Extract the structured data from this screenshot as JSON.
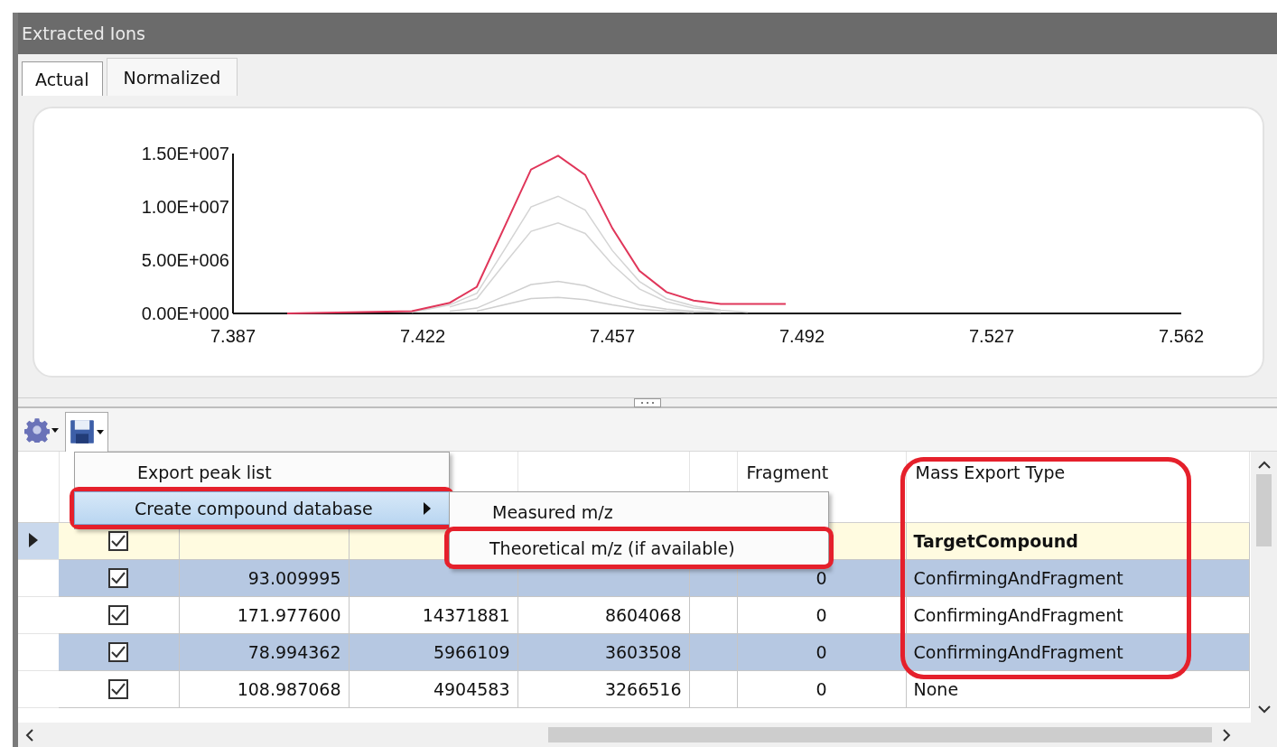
{
  "panel": {
    "title": "Extracted Ions"
  },
  "tabs": [
    {
      "label": "Actual",
      "selected": true
    },
    {
      "label": "Normalized",
      "selected": false
    }
  ],
  "chart": {
    "chart_data": {
      "type": "line",
      "x": [
        7.397,
        7.42,
        7.427,
        7.432,
        7.437,
        7.442,
        7.447,
        7.452,
        7.457,
        7.462,
        7.467,
        7.472,
        7.477,
        7.482,
        7.489
      ],
      "xlim": [
        7.387,
        7.562
      ],
      "ylim": [
        0,
        15000000
      ],
      "xticks": [
        {
          "value": 7.387,
          "label": "7.387"
        },
        {
          "value": 7.422,
          "label": "7.422"
        },
        {
          "value": 7.457,
          "label": "7.457"
        },
        {
          "value": 7.492,
          "label": "7.492"
        },
        {
          "value": 7.527,
          "label": "7.527"
        },
        {
          "value": 7.562,
          "label": "7.562"
        }
      ],
      "yticks": [
        {
          "value": 0,
          "label": "0.00E+000"
        },
        {
          "value": 5000000,
          "label": "5.00E+006"
        },
        {
          "value": 10000000,
          "label": "1.00E+007"
        },
        {
          "value": 15000000,
          "label": "1.50E+007"
        }
      ],
      "series": [
        {
          "color": "#e0365a",
          "values": [
            0,
            200000,
            1000000,
            2500000,
            8000000,
            13500000,
            14800000,
            13000000,
            8000000,
            4000000,
            2000000,
            1200000,
            900000,
            900000,
            900000
          ]
        },
        {
          "color": "#d4d4d4",
          "values": [
            null,
            100000,
            800000,
            1900000,
            5900000,
            10000000,
            11000000,
            9700000,
            5900000,
            3000000,
            1400000,
            700000,
            300000,
            100000,
            null
          ]
        },
        {
          "color": "#d4d4d4",
          "values": [
            null,
            null,
            600000,
            1400000,
            4600000,
            7700000,
            8500000,
            7500000,
            4600000,
            2300000,
            1100000,
            500000,
            300000,
            null,
            null
          ]
        },
        {
          "color": "#cfcfcf",
          "values": [
            null,
            null,
            200000,
            500000,
            1600000,
            2700000,
            3000000,
            2600000,
            1600000,
            800000,
            400000,
            200000,
            100000,
            null,
            null
          ]
        },
        {
          "color": "#cfcfcf",
          "values": [
            null,
            null,
            null,
            200000,
            800000,
            1400000,
            1500000,
            1300000,
            800000,
            400000,
            200000,
            100000,
            null,
            null,
            null
          ]
        }
      ]
    }
  },
  "toolbar": [
    {
      "kind": "settings",
      "open": false
    },
    {
      "kind": "save",
      "open": true
    }
  ],
  "menu": {
    "items": [
      {
        "label": "Export peak list",
        "selected": false,
        "annotated": false
      },
      {
        "label": "Create compound database",
        "selected": true,
        "annotated": true,
        "submenu": [
          {
            "label": "Measured m/z",
            "selected": false,
            "annotated": false
          },
          {
            "label": "Theoretical m/z (if available)",
            "selected": false,
            "annotated": true
          }
        ]
      }
    ]
  },
  "table": {
    "columns": [
      {
        "kind": "number"
      },
      {
        "kind": "number"
      },
      {
        "kind": "number"
      },
      {
        "kind": "text"
      },
      {
        "kind": "center",
        "label": "Fragment"
      },
      {
        "kind": "text",
        "label": "Mass Export Type",
        "annotated": true
      }
    ],
    "rows": [
      {
        "selected": true,
        "checked": true,
        "cells": [
          null,
          null,
          null,
          null,
          null,
          "TargetCompound"
        ]
      },
      {
        "selected": false,
        "checked": true,
        "cells": [
          "93.009995",
          null,
          null,
          null,
          "0",
          "ConfirmingAndFragment"
        ]
      },
      {
        "selected": false,
        "checked": true,
        "cells": [
          "171.977600",
          "14371881",
          "8604068",
          null,
          "0",
          "ConfirmingAndFragment"
        ]
      },
      {
        "selected": false,
        "checked": true,
        "cells": [
          "78.994362",
          "5966109",
          "3603508",
          null,
          "0",
          "ConfirmingAndFragment"
        ]
      },
      {
        "selected": false,
        "checked": true,
        "cells": [
          "108.987068",
          "4904583",
          "3266516",
          null,
          "0",
          "None"
        ]
      }
    ]
  }
}
